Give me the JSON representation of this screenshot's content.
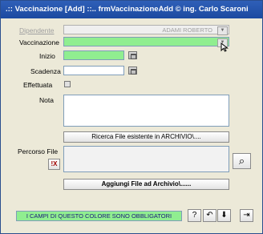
{
  "window": {
    "title": ".:: Vaccinazione [Add] ::..   frmVaccinazioneAdd © ing. Carlo Scaroni"
  },
  "form": {
    "dipendente_label": "Dipendente",
    "dipendente_value": "ADAMI  ROBERTO",
    "vaccinazione_label": "Vaccinazione",
    "vaccinazione_value": "",
    "inizio_label": "Inizio",
    "scadenza_label": "Scadenza",
    "effettuata_label": "Effettuata",
    "effettuata_checked": false,
    "nota_label": "Nota",
    "percorso_file_label": "Percorso File"
  },
  "buttons": {
    "ricerca_file": "Ricerca File esistente in ARCHIVIO\\....",
    "clear_path": "!X",
    "aggiungi_file": "Aggiungi File ad Archivio\\......",
    "search_glyph": "⌕",
    "help_glyph": "?",
    "undo_glyph": "↶",
    "save_glyph": "⬇",
    "exit_glyph": "⇥"
  },
  "footer": {
    "required_hint": "I CAMPI DI QUESTO COLORE SONO OBBLIGATORI"
  },
  "colors": {
    "required_field": "#90ee90",
    "title_bar": "#2f5fb8",
    "window_background": "#ece9d8"
  }
}
